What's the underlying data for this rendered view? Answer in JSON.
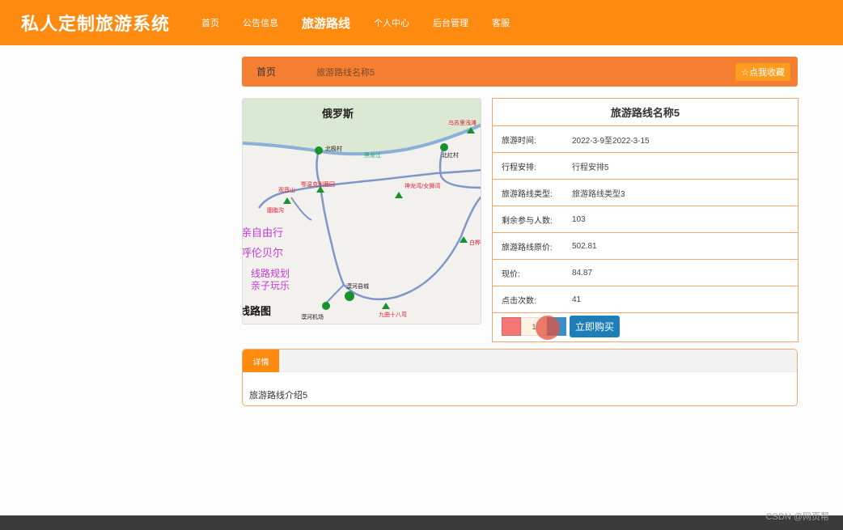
{
  "header": {
    "brand": "私人定制旅游系统",
    "nav": [
      "首页",
      "公告信息",
      "旅游路线",
      "个人中心",
      "后台管理",
      "客服"
    ],
    "active_nav": "旅游路线"
  },
  "breadcrumb": {
    "home": "首页",
    "current": "旅游路线名称5",
    "favorite": "☆点我收藏"
  },
  "map": {
    "country_label": "俄罗斯",
    "places": [
      "北极村",
      "北红村",
      "乌苏里浅滩",
      "黑龙江",
      "观音山",
      "胭脂沟",
      "鄂温克驯鹿园",
      "神龙湾/女狮湾",
      "漠河县城",
      "漠河机场",
      "九曲十八弯",
      "白桦林"
    ],
    "ad_lines": [
      "亲自由行",
      "呼伦贝尔",
      "线路规划",
      "亲子玩乐",
      "线路图"
    ]
  },
  "product": {
    "title": "旅游路线名称5",
    "rows": [
      {
        "label": "旅游时间:",
        "value": "2022-3-9至2022-3-15"
      },
      {
        "label": "行程安排:",
        "value": "行程安排5"
      },
      {
        "label": "旅游路线类型:",
        "value": "旅游路线类型3"
      },
      {
        "label": "剩余参与人数:",
        "value": "103"
      },
      {
        "label": "旅游路线原价:",
        "value": "502.81"
      },
      {
        "label": "现价:",
        "value": "84.87"
      },
      {
        "label": "点击次数:",
        "value": "41"
      }
    ],
    "quantity": "1",
    "buy_label": "立即购买"
  },
  "detail": {
    "tab": "详情",
    "content": "旅游路线介绍5"
  },
  "watermark": "CSDN @网页帮",
  "colors": {
    "header_orange": "#ff8a10",
    "breadcrumb_orange": "#f47f33",
    "buy_blue": "#1e7fb8"
  }
}
